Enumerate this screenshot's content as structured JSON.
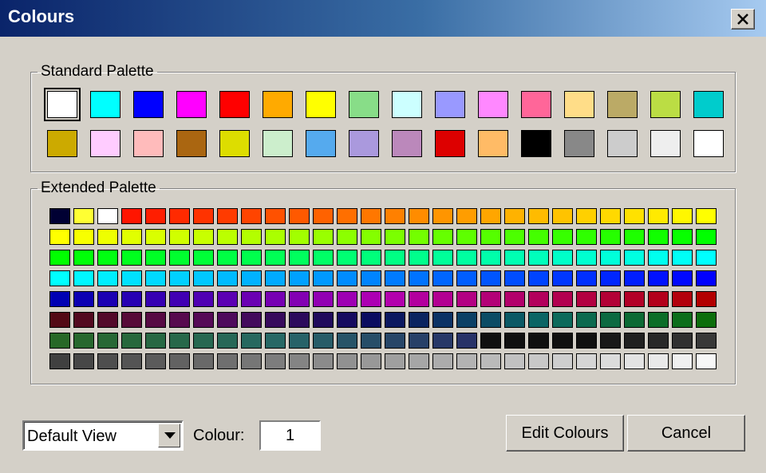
{
  "window": {
    "title": "Colours"
  },
  "standard_palette": {
    "label": "Standard Palette",
    "selected_index": 0,
    "rows": [
      [
        "#ffffff",
        "#00ffff",
        "#0000ff",
        "#ff00ff",
        "#ff0000",
        "#ffaa00",
        "#ffff00",
        "#88dd88",
        "#ccffff",
        "#9999ff",
        "#ff88ff",
        "#ff6699",
        "#ffdd88",
        "#bbaa66",
        "#bbdd44",
        "#00cccc"
      ],
      [
        "#ccaa00",
        "#ffccff",
        "#ffbbbb",
        "#aa6611",
        "#dddd00",
        "#cceecc",
        "#55aaee",
        "#aa99dd",
        "#bb88bb",
        "#dd0000",
        "#ffbb66",
        "#000000",
        "#888888",
        "#cccccc",
        "#eeeeee",
        "#ffffff"
      ]
    ]
  },
  "extended_palette": {
    "label": "Extended Palette",
    "columns": 28,
    "row_count": 8
  },
  "view_select": {
    "value": "Default View"
  },
  "colour_field": {
    "label": "Colour:",
    "value": "1"
  },
  "buttons": {
    "edit": "Edit Colours",
    "cancel": "Cancel"
  }
}
